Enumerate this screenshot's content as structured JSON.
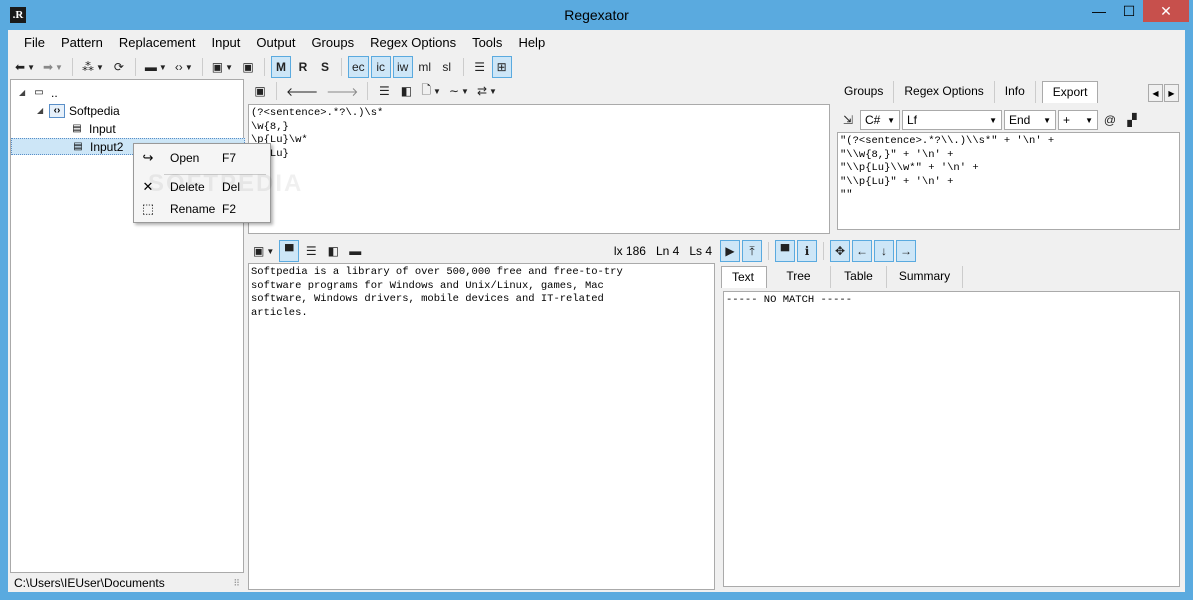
{
  "window": {
    "title": "Regexator",
    "minimize": "—",
    "maximize": "☐",
    "close": "✕",
    "app_icon": ".R"
  },
  "menu": [
    "File",
    "Pattern",
    "Replacement",
    "Input",
    "Output",
    "Groups",
    "Regex Options",
    "Tools",
    "Help"
  ],
  "toolbar": {
    "opt_m": "M",
    "opt_r": "R",
    "opt_s": "S",
    "opt_ec": "ec",
    "opt_ic": "ic",
    "opt_iw": "iw",
    "opt_ml": "ml",
    "opt_sl": "sl"
  },
  "tree": {
    "root": "..",
    "project": "Softpedia",
    "items": [
      "Input",
      "Input2"
    ]
  },
  "context_menu": {
    "items": [
      {
        "icon": "open-icon",
        "label": "Open",
        "key": "F7"
      },
      {
        "icon": "delete-icon",
        "label": "Delete",
        "key": "Del"
      },
      {
        "icon": "rename-icon",
        "label": "Rename",
        "key": "F2"
      }
    ]
  },
  "statusbar": {
    "path": "C:\\Users\\IEUser\\Documents"
  },
  "pattern": {
    "text": "(?<sentence>.*?\\.)\\s*\n\\w{8,}\n\\p{Lu}\\w*\n\\p{Lu}"
  },
  "input": {
    "text": "Softpedia is a library of over 500,000 free and free-to-try\nsoftware programs for Windows and Unix/Linux, games, Mac\nsoftware, Windows drivers, mobile devices and IT-related\narticles.",
    "lx": "lx 186",
    "ln": "Ln 4",
    "ls": "Ls 4"
  },
  "right_tabs": {
    "items": [
      "Groups",
      "Regex Options",
      "Info",
      "Export"
    ],
    "selected": "Export"
  },
  "export": {
    "language": "C#",
    "newline": "Lf",
    "position": "End",
    "concat": "+",
    "at": "@",
    "text": "\"(?<sentence>.*?\\\\.)\\\\s*\" + '\\n' +\n\"\\\\w{8,}\" + '\\n' +\n\"\\\\p{Lu}\\\\w*\" + '\\n' +\n\"\\\\p{Lu}\" + '\\n' +\n\"\""
  },
  "output_tabs": {
    "items": [
      "Text",
      "Tree",
      "Table",
      "Summary"
    ],
    "selected": "Text"
  },
  "output": {
    "text": "----- NO MATCH -----"
  },
  "watermark": "SOFTPEDIA",
  "colors": {
    "titlebar": "#5aaadf",
    "selection": "#cde6f7",
    "close": "#c7504c"
  }
}
